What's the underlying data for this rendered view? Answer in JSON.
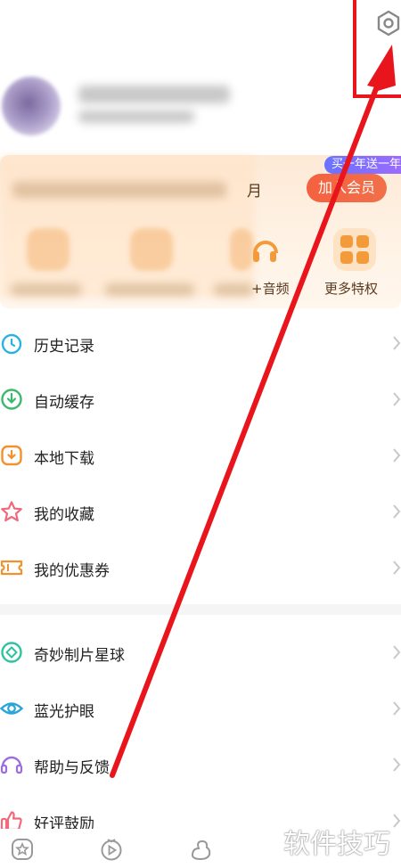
{
  "vip": {
    "tag": "买一年送一年",
    "month_fragment": "月",
    "join_label": "加入会员",
    "privileges": [
      {
        "label": "+音频",
        "icon": "headphones-icon"
      },
      {
        "label": "更多特权",
        "icon": "grid-icon"
      }
    ]
  },
  "menu_group_1": [
    {
      "label": "历史记录",
      "icon": "clock-icon",
      "color": "#2bb3e0"
    },
    {
      "label": "自动缓存",
      "icon": "download-circle-icon",
      "color": "#3cb86a"
    },
    {
      "label": "本地下载",
      "icon": "download-box-icon",
      "color": "#f0922e"
    },
    {
      "label": "我的收藏",
      "icon": "star-icon",
      "color": "#f06a7c"
    },
    {
      "label": "我的优惠券",
      "icon": "ticket-icon",
      "color": "#f0922e"
    }
  ],
  "menu_group_2": [
    {
      "label": "奇妙制片星球",
      "icon": "planet-icon",
      "color": "#2ec2a0"
    },
    {
      "label": "蓝光护眼",
      "icon": "eye-icon",
      "color": "#2ba5d8"
    },
    {
      "label": "帮助与反馈",
      "icon": "headset-icon",
      "color": "#9b6ee0"
    },
    {
      "label": "好评鼓励",
      "icon": "thumbs-up-icon",
      "color": "#f06a7c"
    }
  ],
  "watermark": "软件技巧",
  "colors": {
    "accent_orange": "#f5613f",
    "annotation_red": "#e8161c"
  }
}
